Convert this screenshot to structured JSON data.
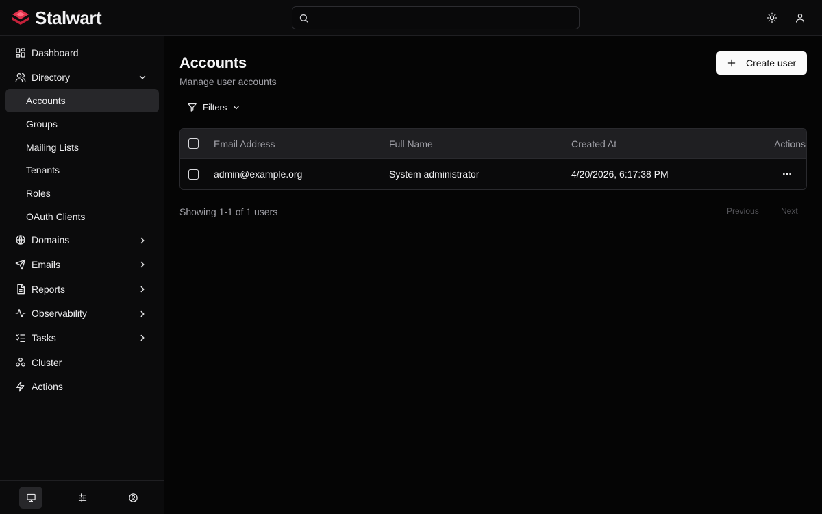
{
  "app": {
    "name": "Stalwart"
  },
  "search": {
    "placeholder": "",
    "value": ""
  },
  "sidebar": {
    "items": [
      {
        "label": "Dashboard"
      },
      {
        "label": "Directory"
      },
      {
        "label": "Domains"
      },
      {
        "label": "Emails"
      },
      {
        "label": "Reports"
      },
      {
        "label": "Observability"
      },
      {
        "label": "Tasks"
      },
      {
        "label": "Cluster"
      },
      {
        "label": "Actions"
      }
    ],
    "directory_sub": [
      {
        "label": "Accounts"
      },
      {
        "label": "Groups"
      },
      {
        "label": "Mailing Lists"
      },
      {
        "label": "Tenants"
      },
      {
        "label": "Roles"
      },
      {
        "label": "OAuth Clients"
      }
    ]
  },
  "page": {
    "title": "Accounts",
    "subtitle": "Manage user accounts",
    "create_label": "Create user",
    "filters_label": "Filters"
  },
  "table": {
    "columns": [
      "Email Address",
      "Full Name",
      "Created At",
      "Actions"
    ],
    "rows": [
      {
        "email": "admin@example.org",
        "name": "System administrator",
        "created": "4/20/2026, 6:17:38 PM"
      }
    ]
  },
  "pagination": {
    "showing": "Showing 1-1 of 1 users",
    "previous": "Previous",
    "next": "Next"
  },
  "colors": {
    "brand": "#e0314b",
    "background": "#050505",
    "sidebar": "#0b0b0c",
    "active": "#27272a"
  }
}
